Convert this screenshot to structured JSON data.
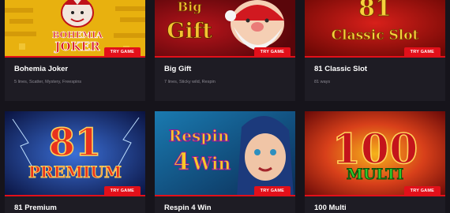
{
  "try_label": "TRY GAME",
  "games": [
    {
      "title": "Bohemia Joker",
      "desc": "5 lines, Scatter, Mystery, Freespins",
      "art": [
        "BOHEMIA",
        "JOKER"
      ]
    },
    {
      "title": "Big Gift",
      "desc": "7 lines, Sticky wild, Respin",
      "art": [
        "Big",
        "Gift"
      ]
    },
    {
      "title": "81 Classic Slot",
      "desc": "81 ways",
      "art": [
        "81",
        "Classic Slot"
      ]
    },
    {
      "title": "81 Premium",
      "desc": "",
      "art": [
        "81",
        "PREMIUM"
      ]
    },
    {
      "title": "Respin 4 Win",
      "desc": "",
      "art": [
        "Respin",
        "4",
        "Win"
      ]
    },
    {
      "title": "100 Multi",
      "desc": "",
      "art": [
        "100",
        "MULTI"
      ]
    }
  ]
}
